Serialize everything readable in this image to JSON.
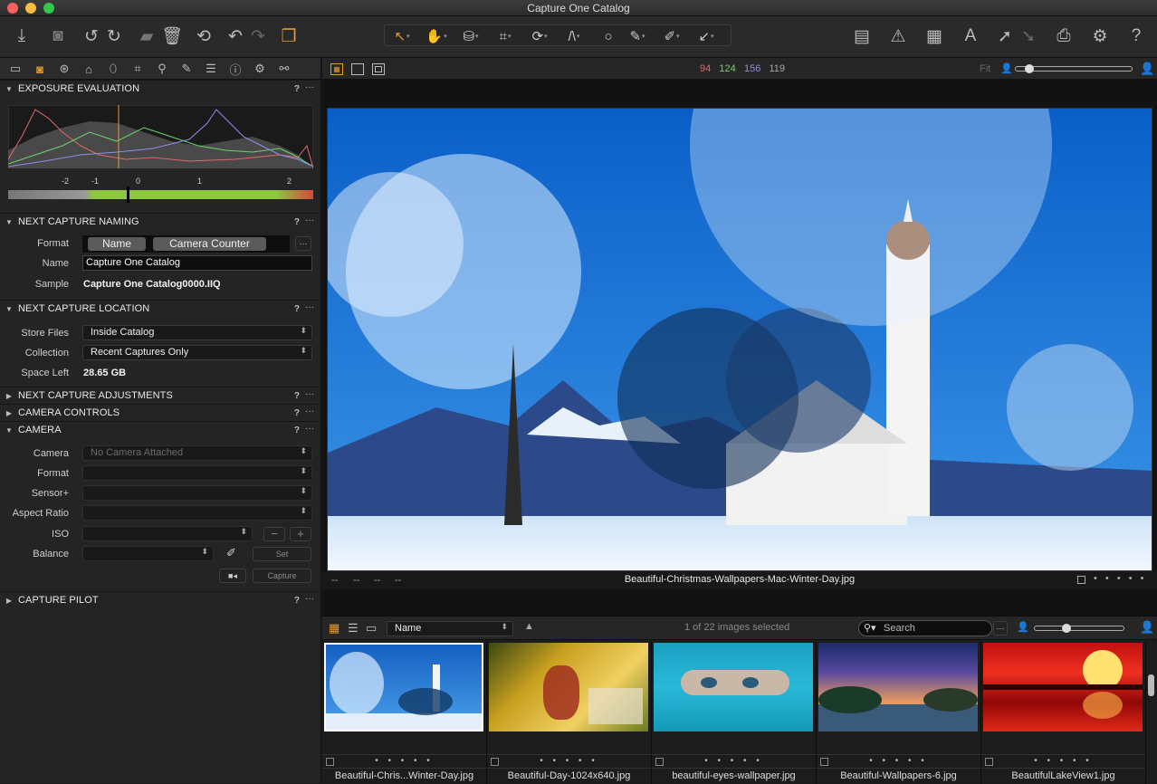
{
  "window": {
    "title": "Capture One Catalog"
  },
  "colors": {
    "accent": "#e59a36",
    "red": "#e06a6a",
    "green": "#6cd46c",
    "blue": "#8e8ef0"
  },
  "toolbar": {
    "icons": [
      "import-icon",
      "camera-icon",
      "rotate-left-icon",
      "rotate-right-icon",
      "folder-move-icon",
      "trash-icon",
      "undo-all-icon",
      "undo-icon",
      "redo-icon",
      "variants-icon"
    ],
    "cursor_tools": [
      "select-cursor-icon",
      "pan-icon",
      "loupe-icon",
      "crop-icon",
      "rotate-icon",
      "keystone-icon",
      "circle-mask-icon",
      "brush-icon",
      "picker-icon",
      "apply-icon"
    ],
    "right_icons": [
      "layout-icon",
      "exposure-warning-icon",
      "grid-icon",
      "text-overlay-icon",
      "adjustments-copy-icon",
      "adjustments-apply-icon",
      "print-icon",
      "settings-icon",
      "help-icon"
    ]
  },
  "sidebar": {
    "tool_tabs": [
      "library-icon",
      "capture-icon",
      "color-icon",
      "exposure-icon",
      "lens-icon",
      "crop-icon",
      "details-icon",
      "local-adjust-icon",
      "output-icon",
      "metadata-icon",
      "settings-icon",
      "batch-icon"
    ],
    "exposure_evaluation": {
      "title": "EXPOSURE EVALUATION",
      "scale": [
        "-2",
        "-1",
        "0",
        "1",
        "2"
      ]
    },
    "naming": {
      "title": "NEXT CAPTURE NAMING",
      "format_label": "Format",
      "token1": "Name",
      "token2": "Camera Counter",
      "name_label": "Name",
      "name_value": "Capture One Catalog",
      "sample_label": "Sample",
      "sample_value": "Capture One Catalog0000.IIQ"
    },
    "location": {
      "title": "NEXT CAPTURE LOCATION",
      "store_label": "Store Files",
      "store_value": "Inside Catalog",
      "collection_label": "Collection",
      "collection_value": "Recent Captures Only",
      "space_label": "Space Left",
      "space_value": "28.65 GB"
    },
    "adjustments": {
      "title": "NEXT CAPTURE ADJUSTMENTS"
    },
    "controls": {
      "title": "CAMERA CONTROLS"
    },
    "camera": {
      "title": "CAMERA",
      "camera_label": "Camera",
      "camera_value": "No Camera Attached",
      "format_label": "Format",
      "sensor_label": "Sensor+",
      "aspect_label": "Aspect Ratio",
      "iso_label": "ISO",
      "balance_label": "Balance",
      "set_label": "Set",
      "capture_label": "Capture"
    },
    "pilot": {
      "title": "CAPTURE PILOT"
    },
    "help": "?",
    "more": "···"
  },
  "viewer": {
    "readout": {
      "r": "94",
      "g": "124",
      "b": "156",
      "l": "119"
    },
    "fit_label": "Fit",
    "filename": "Beautiful-Christmas-Wallpapers-Mac-Winter-Day.jpg",
    "placeholders": [
      "--",
      "--",
      "--",
      "--"
    ],
    "rating_dots": "• • • • •"
  },
  "browser": {
    "sort_value": "Name",
    "selection": "1 of 22 images selected",
    "search_placeholder": "Search",
    "thumbnails": [
      {
        "name": "Beautiful-Chris...Winter-Day.jpg"
      },
      {
        "name": "Beautiful-Day-1024x640.jpg"
      },
      {
        "name": "beautiful-eyes-wallpaper.jpg"
      },
      {
        "name": "Beautiful-Wallpapers-6.jpg"
      },
      {
        "name": "BeautifulLakeView1.jpg"
      }
    ]
  }
}
